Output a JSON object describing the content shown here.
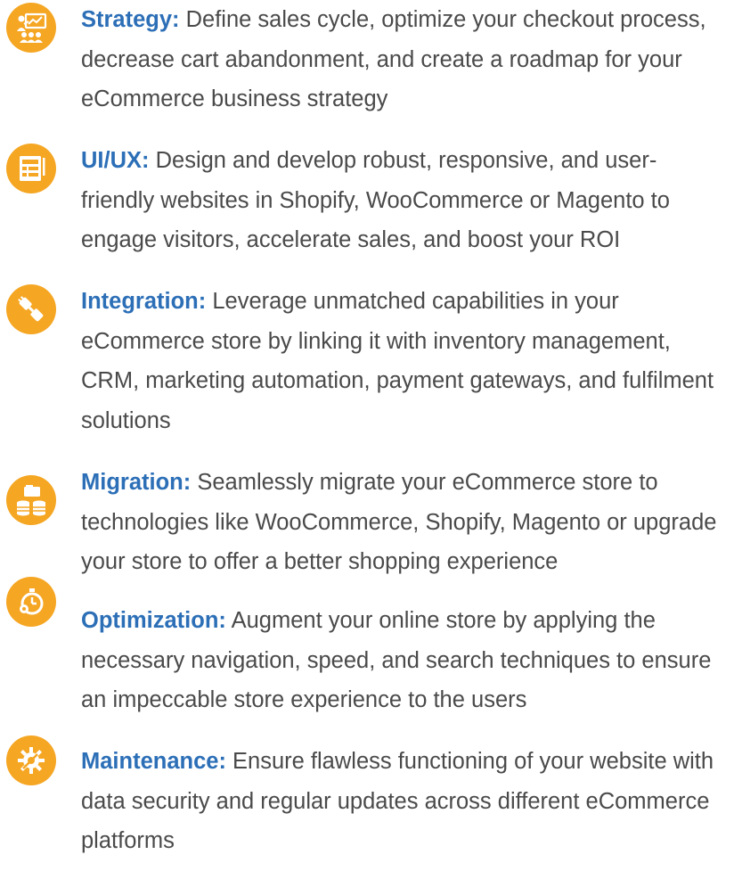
{
  "colors": {
    "accent": "#2c6fb7",
    "icon_bg": "#f5a623",
    "body_text": "#4a4a4a"
  },
  "items": [
    {
      "title": "Strategy:",
      "description": "Define sales cycle, optimize your checkout process, decrease cart abandonment, and create a roadmap for your eCommerce business strategy",
      "icon": "presentation-icon"
    },
    {
      "title": "UI/UX:",
      "description": "Design and develop robust, responsive, and user-friendly websites in Shopify, WooCommerce or Magento to engage visitors, accelerate sales, and boost your ROI",
      "icon": "layout-icon"
    },
    {
      "title": "Integration:",
      "description": "Leverage unmatched capabilities in your eCommerce store by linking it with inventory management, CRM, marketing automation, payment gateways, and fulfilment solutions",
      "icon": "plug-icon"
    },
    {
      "title": "Migration:",
      "description": "Seamlessly migrate your eCommerce store to technologies like WooCommerce, Shopify, Magento or upgrade your store to offer a better shopping experience",
      "icon": "database-transfer-icon"
    },
    {
      "title": "Optimization:",
      "description": "Augment your online store by applying the necessary navigation, speed, and search techniques to ensure an impeccable store experience to the users",
      "icon": "stopwatch-gear-icon"
    },
    {
      "title": "Maintenance:",
      "description": "Ensure flawless functioning of your website with data security and regular updates across different eCommerce platforms",
      "icon": "gear-wrench-icon"
    }
  ]
}
